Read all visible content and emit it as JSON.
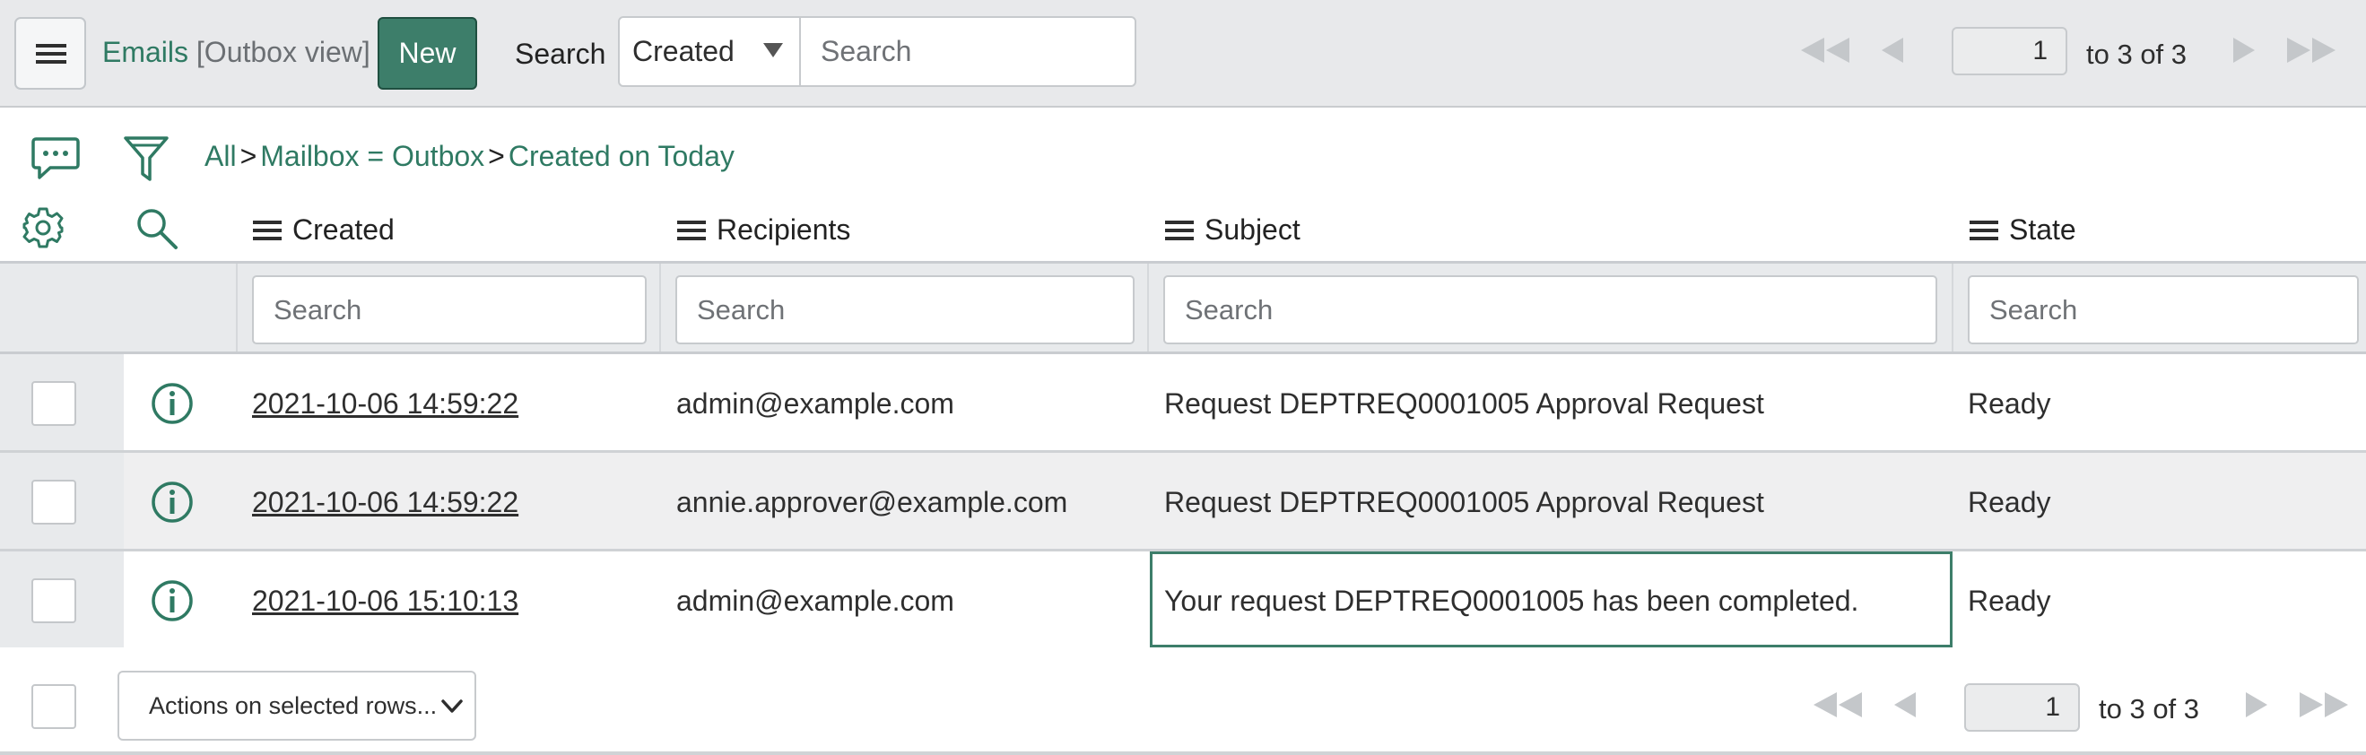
{
  "header": {
    "app_title": "Emails",
    "view_label": "[Outbox view]",
    "new_button": "New",
    "search_label": "Search",
    "search_field": "Created",
    "search_placeholder": "Search"
  },
  "pager": {
    "page": "1",
    "range_text": "to 3 of 3"
  },
  "breadcrumb": {
    "items": [
      "All",
      "Mailbox = Outbox",
      "Created on Today"
    ],
    "separator": ">"
  },
  "columns": [
    "Created",
    "Recipients",
    "Subject",
    "State"
  ],
  "column_search_placeholder": "Search",
  "rows": [
    {
      "created": "2021-10-06 14:59:22",
      "recipients": "admin@example.com",
      "subject": "Request DEPTREQ0001005 Approval Request",
      "state": "Ready"
    },
    {
      "created": "2021-10-06 14:59:22",
      "recipients": "annie.approver@example.com",
      "subject": "Request DEPTREQ0001005 Approval Request",
      "state": "Ready"
    },
    {
      "created": "2021-10-06 15:10:13",
      "recipients": "admin@example.com",
      "subject": "Your request DEPTREQ0001005 has been completed.",
      "state": "Ready"
    }
  ],
  "footer": {
    "actions_label": "Actions on selected rows..."
  },
  "icons": {
    "menu": "hamburger-menu-icon",
    "comments": "speech-bubble-icon",
    "filter": "funnel-icon",
    "settings": "gear-icon",
    "search": "magnifier-icon",
    "info": "info-circle-icon",
    "first": "double-chevron-left-icon",
    "prev": "chevron-left-icon",
    "next": "chevron-right-icon",
    "last": "double-chevron-right-icon"
  },
  "colors": {
    "accent": "#3d7e6a",
    "link": "#2f7a63",
    "header_bg": "#e8e9eb"
  }
}
